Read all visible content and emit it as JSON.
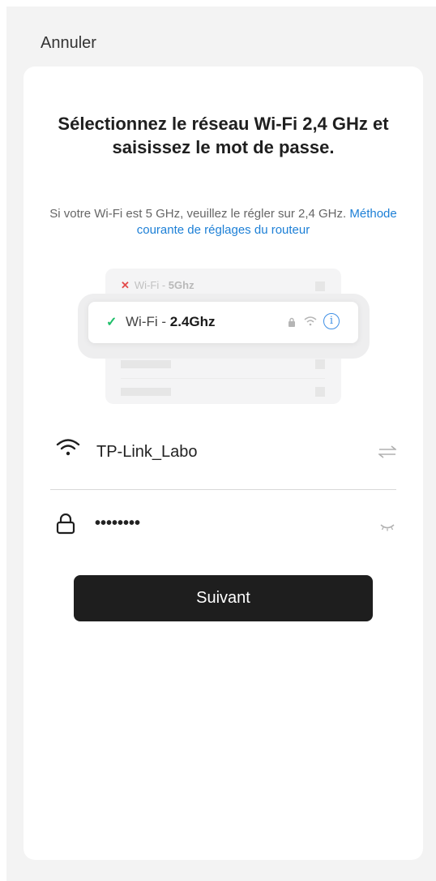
{
  "header": {
    "cancel_label": "Annuler"
  },
  "main": {
    "title": "Sélectionnez le réseau Wi-Fi 2,4 GHz et saisissez le mot de passe.",
    "subtitle_text": "Si votre Wi-Fi est 5 GHz, veuillez le régler sur 2,4 GHz. ",
    "subtitle_link": "Méthode courante de réglages du routeur"
  },
  "illustration": {
    "row_5ghz_prefix": "Wi-Fi - ",
    "row_5ghz_band": "5Ghz",
    "row_24ghz_prefix": "Wi-Fi - ",
    "row_24ghz_band": "2.4Ghz",
    "cross_color": "#e34b4b",
    "check_color": "#1fbf6a",
    "info_color": "#3f8fe5"
  },
  "form": {
    "wifi_icon": "wifi-icon",
    "ssid_value": "TP-Link_Labo",
    "switch_icon": "switch-network-icon",
    "lock_icon": "lock-icon",
    "password_value": "••••••••",
    "eye_icon": "eye-closed-icon"
  },
  "actions": {
    "next_label": "Suivant",
    "next_color": "#1e1e1e",
    "link_color": "#1c7fd6"
  }
}
